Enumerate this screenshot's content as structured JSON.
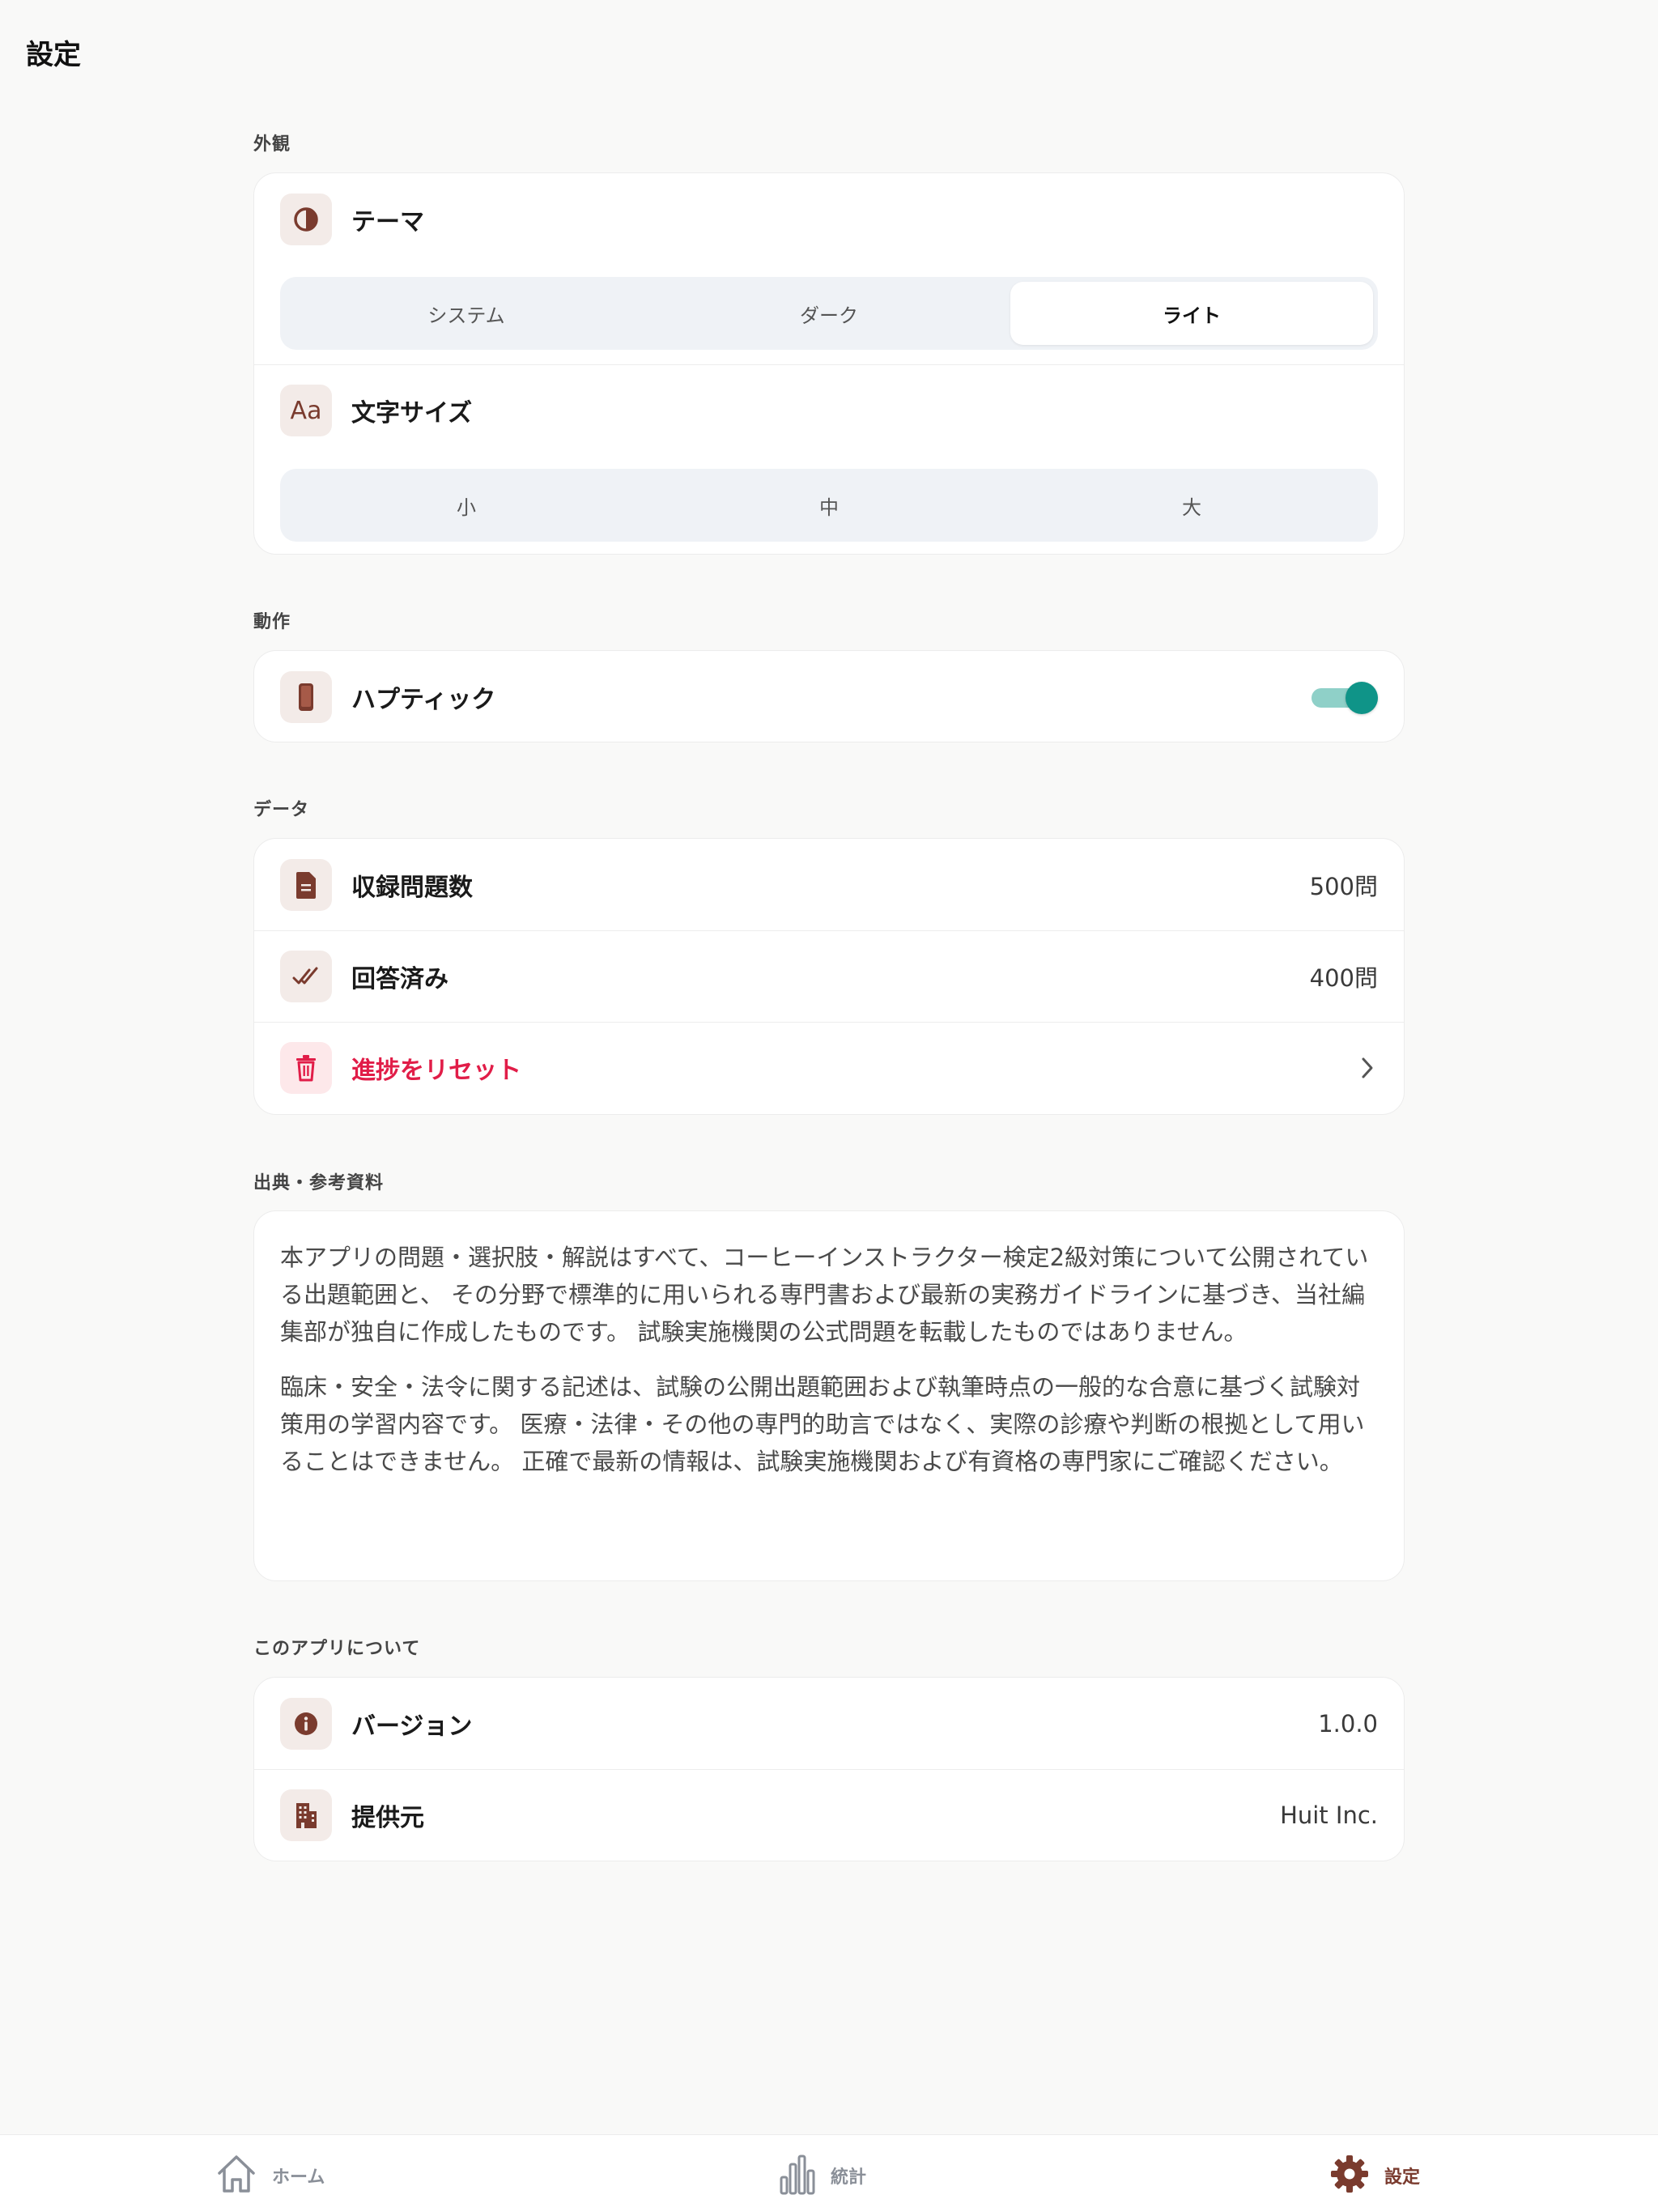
{
  "page": {
    "title": "設定"
  },
  "sections": {
    "appearance": {
      "label": "外観",
      "theme": {
        "label": "テーマ",
        "icon": "contrast-icon",
        "options": [
          "システム",
          "ダーク",
          "ライト"
        ],
        "selected": "ライト"
      },
      "font_size": {
        "label": "文字サイズ",
        "icon": "text-size-icon",
        "icon_text": "Aa",
        "options": [
          "小",
          "中",
          "大"
        ],
        "selected": ""
      }
    },
    "behavior": {
      "label": "動作",
      "haptic": {
        "label": "ハプティック",
        "icon": "phone-icon",
        "enabled": true
      }
    },
    "data": {
      "label": "データ",
      "total": {
        "label": "収録問題数",
        "value": "500問",
        "icon": "document-icon"
      },
      "answered": {
        "label": "回答済み",
        "value": "400問",
        "icon": "double-check-icon"
      },
      "reset": {
        "label": "進捗をリセット",
        "icon": "trash-icon"
      }
    },
    "sources": {
      "label": "出典・参考資料",
      "paragraph1": "本アプリの問題・選択肢・解説はすべて、コーヒーインストラクター検定2級対策について公開されている出題範囲と、 その分野で標準的に用いられる専門書および最新の実務ガイドラインに基づき、当社編集部が独自に作成したものです。 試験実施機関の公式問題を転載したものではありません。",
      "paragraph2": "臨床・安全・法令に関する記述は、試験の公開出題範囲および執筆時点の一般的な合意に基づく試験対策用の学習内容です。 医療・法律・その他の専門的助言ではなく、実際の診療や判断の根拠として用いることはできません。 正確で最新の情報は、試験実施機関および有資格の専門家にご確認ください。"
    },
    "about": {
      "label": "このアプリについて",
      "version": {
        "label": "バージョン",
        "value": "1.0.0",
        "icon": "info-icon"
      },
      "provider": {
        "label": "提供元",
        "value": "Huit Inc.",
        "icon": "building-icon"
      }
    }
  },
  "tabbar": {
    "items": [
      {
        "label": "ホーム",
        "icon": "home-icon"
      },
      {
        "label": "統計",
        "icon": "bar-chart-icon"
      },
      {
        "label": "設定",
        "icon": "gear-icon",
        "active": true
      }
    ]
  },
  "colors": {
    "accent": "#7a3b2e",
    "icon_bg": "#f3ebe8",
    "danger": "#e11d48",
    "toggle_on": "#0f9488",
    "inactive_tab": "#8a8f98"
  }
}
